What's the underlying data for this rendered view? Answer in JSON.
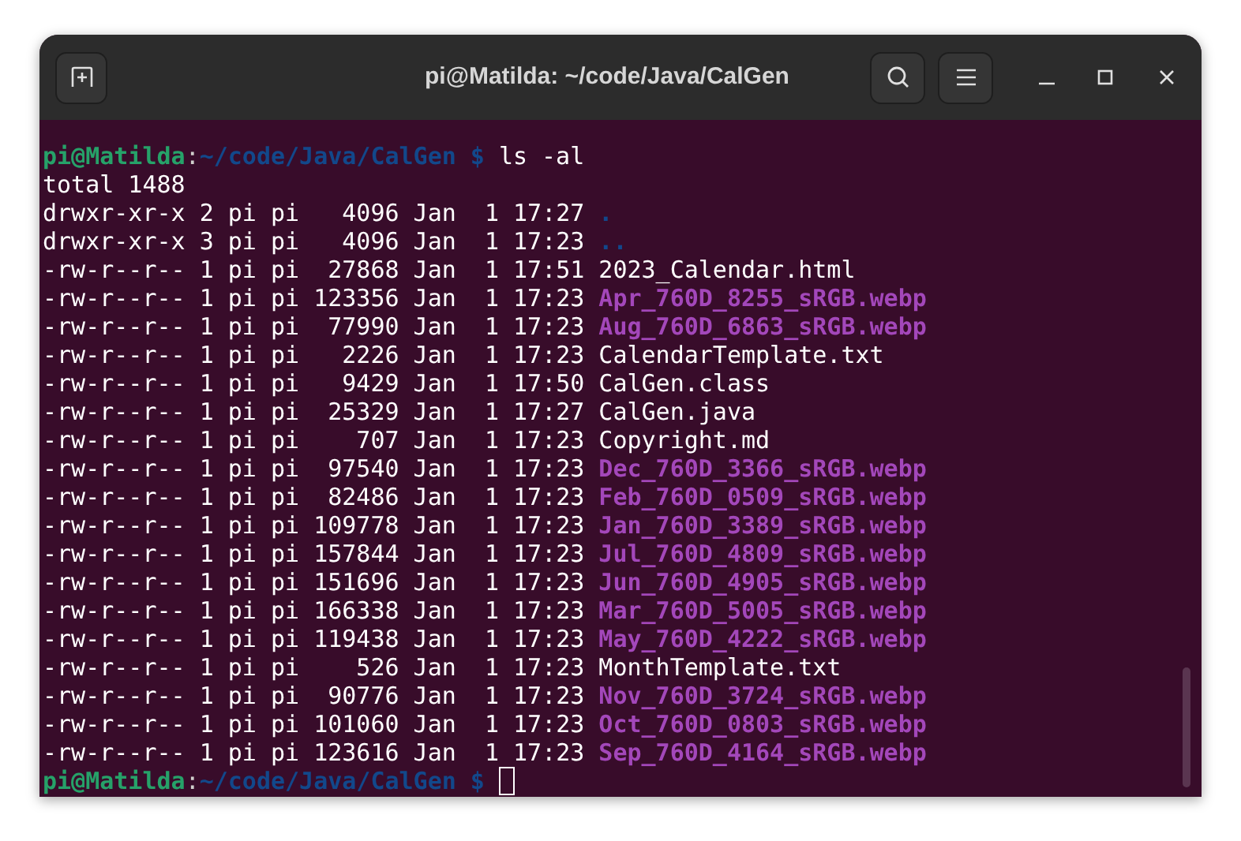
{
  "window": {
    "title": "pi@Matilda: ~/code/Java/CalGen"
  },
  "prompts": [
    {
      "user": "pi@Matilda",
      "separator": ":",
      "path": "~/code/Java/CalGen",
      "symbol": "$",
      "command": "ls -al",
      "cursor": false
    },
    {
      "user": "pi@Matilda",
      "separator": ":",
      "path": "~/code/Java/CalGen",
      "symbol": "$",
      "cursor": true
    }
  ],
  "total": "total 1488",
  "entries": [
    {
      "info": "drwxr-xr-x 2 pi pi   4096 Jan  1 17:27",
      "name": ".",
      "kind": "dir"
    },
    {
      "info": "drwxr-xr-x 3 pi pi   4096 Jan  1 17:23",
      "name": "..",
      "kind": "dir"
    },
    {
      "info": "-rw-r--r-- 1 pi pi  27868 Jan  1 17:51",
      "name": "2023_Calendar.html",
      "kind": "file"
    },
    {
      "info": "-rw-r--r-- 1 pi pi 123356 Jan  1 17:23",
      "name": "Apr_760D_8255_sRGB.webp",
      "kind": "image"
    },
    {
      "info": "-rw-r--r-- 1 pi pi  77990 Jan  1 17:23",
      "name": "Aug_760D_6863_sRGB.webp",
      "kind": "image"
    },
    {
      "info": "-rw-r--r-- 1 pi pi   2226 Jan  1 17:23",
      "name": "CalendarTemplate.txt",
      "kind": "file"
    },
    {
      "info": "-rw-r--r-- 1 pi pi   9429 Jan  1 17:50",
      "name": "CalGen.class",
      "kind": "file"
    },
    {
      "info": "-rw-r--r-- 1 pi pi  25329 Jan  1 17:27",
      "name": "CalGen.java",
      "kind": "file"
    },
    {
      "info": "-rw-r--r-- 1 pi pi    707 Jan  1 17:23",
      "name": "Copyright.md",
      "kind": "file"
    },
    {
      "info": "-rw-r--r-- 1 pi pi  97540 Jan  1 17:23",
      "name": "Dec_760D_3366_sRGB.webp",
      "kind": "image"
    },
    {
      "info": "-rw-r--r-- 1 pi pi  82486 Jan  1 17:23",
      "name": "Feb_760D_0509_sRGB.webp",
      "kind": "image"
    },
    {
      "info": "-rw-r--r-- 1 pi pi 109778 Jan  1 17:23",
      "name": "Jan_760D_3389_sRGB.webp",
      "kind": "image"
    },
    {
      "info": "-rw-r--r-- 1 pi pi 157844 Jan  1 17:23",
      "name": "Jul_760D_4809_sRGB.webp",
      "kind": "image"
    },
    {
      "info": "-rw-r--r-- 1 pi pi 151696 Jan  1 17:23",
      "name": "Jun_760D_4905_sRGB.webp",
      "kind": "image"
    },
    {
      "info": "-rw-r--r-- 1 pi pi 166338 Jan  1 17:23",
      "name": "Mar_760D_5005_sRGB.webp",
      "kind": "image"
    },
    {
      "info": "-rw-r--r-- 1 pi pi 119438 Jan  1 17:23",
      "name": "May_760D_4222_sRGB.webp",
      "kind": "image"
    },
    {
      "info": "-rw-r--r-- 1 pi pi    526 Jan  1 17:23",
      "name": "MonthTemplate.txt",
      "kind": "file"
    },
    {
      "info": "-rw-r--r-- 1 pi pi  90776 Jan  1 17:23",
      "name": "Nov_760D_3724_sRGB.webp",
      "kind": "image"
    },
    {
      "info": "-rw-r--r-- 1 pi pi 101060 Jan  1 17:23",
      "name": "Oct_760D_0803_sRGB.webp",
      "kind": "image"
    },
    {
      "info": "-rw-r--r-- 1 pi pi 123616 Jan  1 17:23",
      "name": "Sep_760D_4164_sRGB.webp",
      "kind": "image"
    }
  ]
}
